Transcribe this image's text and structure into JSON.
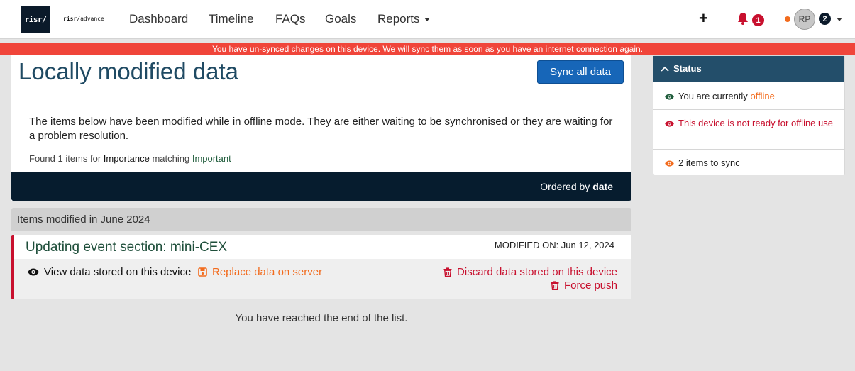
{
  "brand": {
    "logo_text": "risr/",
    "sub_brand_bold": "risr",
    "sub_brand_rest": "/advance"
  },
  "nav": {
    "items": [
      {
        "label": "Dashboard"
      },
      {
        "label": "Timeline"
      },
      {
        "label": "FAQs"
      },
      {
        "label": "Goals"
      },
      {
        "label": "Reports"
      }
    ],
    "notifications_count": "1",
    "user_initials": "RP",
    "user_badge_count": "2"
  },
  "banner": {
    "text": "You have un-synced changes on this device. We will sync them as soon as you have an internet connection again."
  },
  "main": {
    "title": "Locally modified data",
    "sync_button": "Sync all data",
    "intro": "The items below have been modified while in offline mode. They are either waiting to be synchronised or they are waiting for a problem resolution.",
    "found_prefix": "Found 1 items for",
    "found_key": "Importance",
    "found_mid": "matching",
    "found_value": "Important",
    "order_prefix": "Ordered by",
    "order_field": "date"
  },
  "group": {
    "label": "Items modified in June 2024"
  },
  "item": {
    "title": "Updating event section: mini-CEX",
    "modified_label": "MODIFIED ON: Jun 12, 2024",
    "view_label": "View data stored on this device",
    "replace_label": "Replace data on server",
    "discard_label": "Discard data stored on this device",
    "force_label": "Force push"
  },
  "list_end": "You have reached the end of the list.",
  "status": {
    "header": "Status",
    "offline_prefix": "You are currently",
    "offline_value": "offline",
    "device_not_ready": "This device is not ready for offline use",
    "items_to_sync": "2 items to sync"
  },
  "colors": {
    "accent_blue": "#1766b8",
    "danger_red": "#c8102e",
    "warning_orange": "#f26b1d",
    "navy": "#061c2e",
    "status_header": "#234e6a"
  }
}
